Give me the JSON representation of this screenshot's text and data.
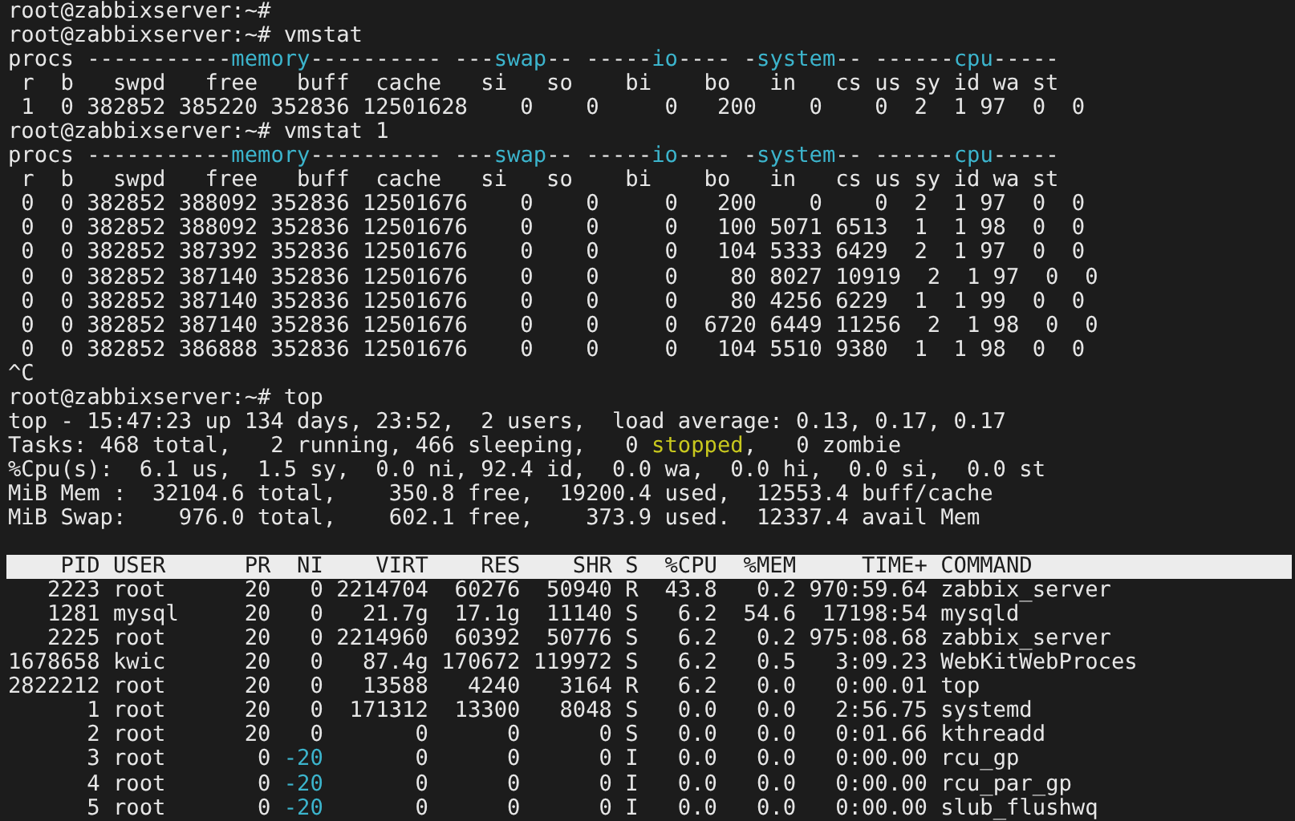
{
  "terminal": {
    "lines": [
      {
        "kind": "text",
        "segments": [
          {
            "text": "root@zabbixserver:~#"
          }
        ]
      },
      {
        "kind": "text",
        "segments": [
          {
            "text": "root@zabbixserver:~# vmstat"
          }
        ]
      },
      {
        "kind": "text",
        "segments": [
          {
            "text": "procs -----------"
          },
          {
            "text": "memory",
            "color": "#3cb4cc"
          },
          {
            "text": "---------- ---"
          },
          {
            "text": "swap",
            "color": "#3cb4cc"
          },
          {
            "text": "-- -----"
          },
          {
            "text": "io",
            "color": "#3cb4cc"
          },
          {
            "text": "---- -"
          },
          {
            "text": "system",
            "color": "#3cb4cc"
          },
          {
            "text": "-- ------"
          },
          {
            "text": "cpu",
            "color": "#3cb4cc"
          },
          {
            "text": "-----"
          }
        ]
      },
      {
        "kind": "text",
        "segments": [
          {
            "text": " r  b   swpd   free   buff  cache   si   so    bi    bo   in   cs us sy id wa st"
          }
        ]
      },
      {
        "kind": "text",
        "segments": [
          {
            "text": " 1  0 382852 385220 352836 12501628    0    0     0   200    0    0  2  1 97  0  0"
          }
        ]
      },
      {
        "kind": "text",
        "segments": [
          {
            "text": "root@zabbixserver:~# vmstat 1"
          }
        ]
      },
      {
        "kind": "text",
        "segments": [
          {
            "text": "procs -----------"
          },
          {
            "text": "memory",
            "color": "#3cb4cc"
          },
          {
            "text": "---------- ---"
          },
          {
            "text": "swap",
            "color": "#3cb4cc"
          },
          {
            "text": "-- -----"
          },
          {
            "text": "io",
            "color": "#3cb4cc"
          },
          {
            "text": "---- -"
          },
          {
            "text": "system",
            "color": "#3cb4cc"
          },
          {
            "text": "-- ------"
          },
          {
            "text": "cpu",
            "color": "#3cb4cc"
          },
          {
            "text": "-----"
          }
        ]
      },
      {
        "kind": "text",
        "segments": [
          {
            "text": " r  b   swpd   free   buff  cache   si   so    bi    bo   in   cs us sy id wa st"
          }
        ]
      },
      {
        "kind": "text",
        "segments": [
          {
            "text": " 0  0 382852 388092 352836 12501676    0    0     0   200    0    0  2  1 97  0  0"
          }
        ]
      },
      {
        "kind": "text",
        "segments": [
          {
            "text": " 0  0 382852 388092 352836 12501676    0    0     0   100 5071 6513  1  1 98  0  0"
          }
        ]
      },
      {
        "kind": "text",
        "segments": [
          {
            "text": " 0  0 382852 387392 352836 12501676    0    0     0   104 5333 6429  2  1 97  0  0"
          }
        ]
      },
      {
        "kind": "text",
        "segments": [
          {
            "text": " 0  0 382852 387140 352836 12501676    0    0     0    80 8027 10919  2  1 97  0  0"
          }
        ]
      },
      {
        "kind": "text",
        "segments": [
          {
            "text": " 0  0 382852 387140 352836 12501676    0    0     0    80 4256 6229  1  1 99  0  0"
          }
        ]
      },
      {
        "kind": "text",
        "segments": [
          {
            "text": " 0  0 382852 387140 352836 12501676    0    0     0  6720 6449 11256  2  1 98  0  0"
          }
        ]
      },
      {
        "kind": "text",
        "segments": [
          {
            "text": " 0  0 382852 386888 352836 12501676    0    0     0   104 5510 9380  1  1 98  0  0"
          }
        ]
      },
      {
        "kind": "text",
        "segments": [
          {
            "text": "^C"
          }
        ]
      },
      {
        "kind": "text",
        "segments": [
          {
            "text": "root@zabbixserver:~# top"
          }
        ]
      },
      {
        "kind": "text",
        "segments": [
          {
            "text": "top - 15:47:23 up 134 days, 23:52,  2 users,  load average: 0.13, 0.17, 0.17"
          }
        ]
      },
      {
        "kind": "text",
        "segments": [
          {
            "text": "Tasks: 468 total,   2 running, 466 sleeping,   0 "
          },
          {
            "text": "stopped",
            "color": "#c8c81e"
          },
          {
            "text": ",   0 zombie"
          }
        ]
      },
      {
        "kind": "text",
        "segments": [
          {
            "text": "%Cpu(s):  6.1 us,  1.5 sy,  0.0 ni, 92.4 id,  0.0 wa,  0.0 hi,  0.0 si,  0.0 st"
          }
        ]
      },
      {
        "kind": "text",
        "segments": [
          {
            "text": "MiB Mem :  32104.6 total,    350.8 free,  19200.4 used,  12553.4 buff/cache"
          }
        ]
      },
      {
        "kind": "text",
        "segments": [
          {
            "text": "MiB Swap:    976.0 total,    602.1 free,    373.9 used.  12337.4 avail Mem"
          }
        ]
      },
      {
        "kind": "blank"
      },
      {
        "kind": "header",
        "segments": [
          {
            "text": "    PID USER      PR  NI    VIRT    RES    SHR S  %CPU  %MEM     TIME+ COMMAND"
          }
        ]
      },
      {
        "kind": "text",
        "segments": [
          {
            "text": "   2223 root      20   0 2214704  60276  50940 R  43.8   0.2 970:59.64 zabbix_server"
          }
        ]
      },
      {
        "kind": "text",
        "segments": [
          {
            "text": "   1281 mysql     20   0   21.7g  17.1g  11140 S   6.2  54.6  17198:54 mysqld"
          }
        ]
      },
      {
        "kind": "text",
        "segments": [
          {
            "text": "   2225 root      20   0 2214960  60392  50776 S   6.2   0.2 975:08.68 zabbix_server"
          }
        ]
      },
      {
        "kind": "text",
        "segments": [
          {
            "text": "1678658 kwic      20   0   87.4g 170672 119972 S   6.2   0.5   3:09.23 WebKitWebProces"
          }
        ]
      },
      {
        "kind": "text",
        "segments": [
          {
            "text": "2822212 root      20   0   13588   4240   3164 R   6.2   0.0   0:00.01 top"
          }
        ]
      },
      {
        "kind": "text",
        "segments": [
          {
            "text": "      1 root      20   0  171312  13300   8048 S   0.0   0.0   2:56.75 systemd"
          }
        ]
      },
      {
        "kind": "text",
        "segments": [
          {
            "text": "      2 root      20   0       0      0      0 S   0.0   0.0   0:01.66 kthreadd"
          }
        ]
      },
      {
        "kind": "text",
        "segments": [
          {
            "text": "      3 root       0 "
          },
          {
            "text": "-20",
            "color": "#3cb4cc"
          },
          {
            "text": "       0      0      0 I   0.0   0.0   0:00.00 rcu_gp"
          }
        ]
      },
      {
        "kind": "text",
        "segments": [
          {
            "text": "      4 root       0 "
          },
          {
            "text": "-20",
            "color": "#3cb4cc"
          },
          {
            "text": "       0      0      0 I   0.0   0.0   0:00.00 rcu_par_gp"
          }
        ]
      },
      {
        "kind": "text",
        "segments": [
          {
            "text": "      5 root       0 "
          },
          {
            "text": "-20",
            "color": "#3cb4cc"
          },
          {
            "text": "       0      0      0 I   0.0   0.0   0:00.00 slub_flushwq"
          }
        ]
      }
    ]
  }
}
